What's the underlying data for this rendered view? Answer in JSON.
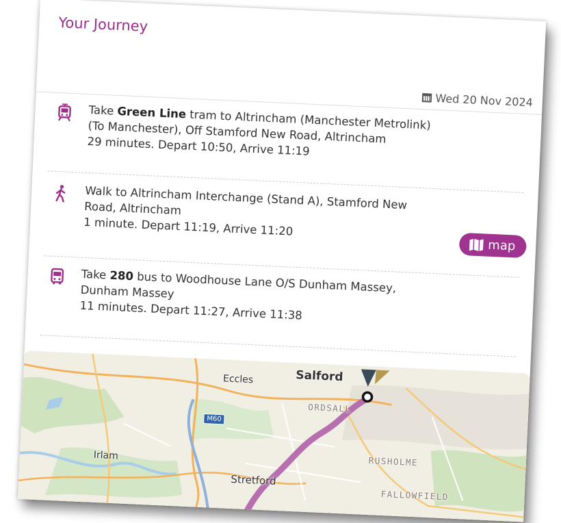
{
  "header": {
    "title": "Your Journey"
  },
  "date": {
    "label": "Wed 20 Nov 2024",
    "icon": "calendar-icon"
  },
  "legs": [
    {
      "icon": "tram-icon",
      "prefix": "Take ",
      "route": "Green Line",
      "line1_rest": " tram to Altrincham (Manchester Metrolink)",
      "line2": "(To Manchester), Off Stamford New Road, Altrincham",
      "timing": "29 minutes. Depart 10:50, Arrive 11:19"
    },
    {
      "icon": "walk-icon",
      "line1": "Walk to Altrincham Interchange (Stand A), Stamford New",
      "line2": "Road, Altrincham",
      "timing": "1 minute. Depart 11:19, Arrive 11:20"
    },
    {
      "icon": "bus-icon",
      "prefix": "Take ",
      "route": "280",
      "line1_rest": " bus to Woodhouse Lane O/S Dunham Massey,",
      "line2": "Dunham Massey",
      "timing": "11 minutes. Depart 11:27, Arrive 11:38"
    }
  ],
  "map_button": {
    "label": "map",
    "icon": "map-icon"
  },
  "map": {
    "labels": {
      "eccles": "Eccles",
      "salford": "Salford",
      "ordsall": "ORDSALL",
      "m60": "M60",
      "irlam": "Irlam",
      "rusholme": "RUSHOLME",
      "stretford": "Stretford",
      "fallowfield": "FALLOWFIELD"
    }
  },
  "colors": {
    "brand": "#9b2f8a",
    "route": "#b060a8",
    "button": "#a0338f"
  }
}
